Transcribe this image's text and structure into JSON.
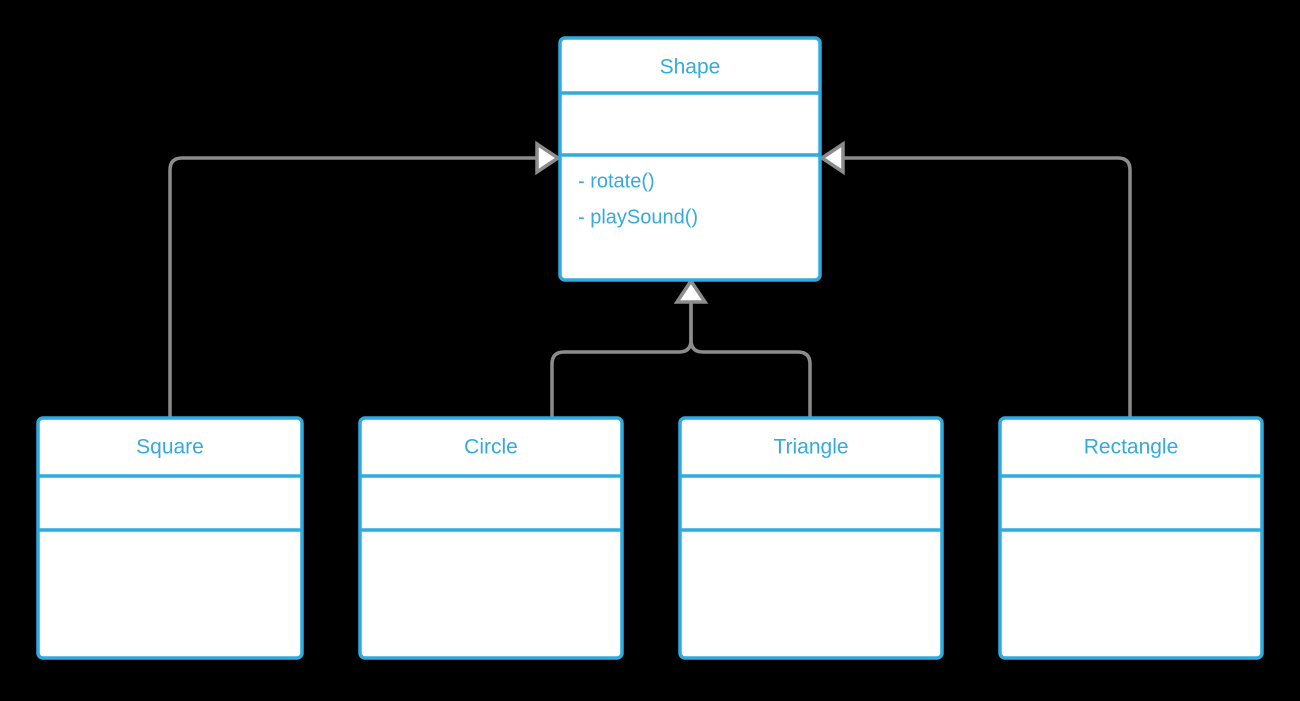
{
  "diagram": {
    "kind": "uml-class-diagram",
    "background_color": "#000000",
    "box_fill_color": "#ffffff",
    "box_border_color": "#2fabdf",
    "text_color": "#36aade",
    "connector_color": "#8c8c8c",
    "arrowhead_fill_color": "#ffffff",
    "relationship_type": "generalization"
  },
  "classes": {
    "shape": {
      "name": "Shape",
      "attributes": [],
      "methods": [
        "- rotate()",
        "- playSound()"
      ]
    },
    "square": {
      "name": "Square",
      "attributes": [],
      "methods": []
    },
    "circle": {
      "name": "Circle",
      "attributes": [],
      "methods": []
    },
    "triangle": {
      "name": "Triangle",
      "attributes": [],
      "methods": []
    },
    "rectangle": {
      "name": "Rectangle",
      "attributes": [],
      "methods": []
    }
  }
}
